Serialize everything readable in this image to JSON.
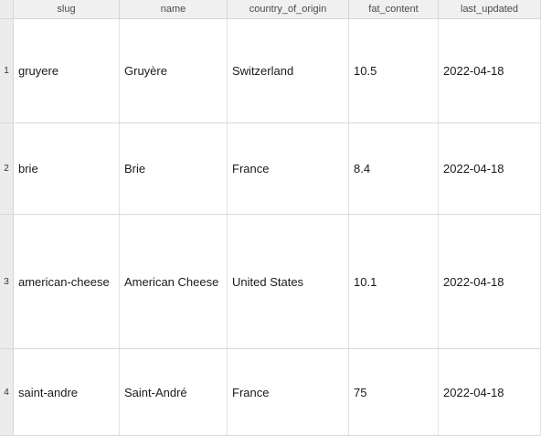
{
  "table": {
    "columns": [
      "slug",
      "name",
      "country_of_origin",
      "fat_content",
      "last_updated"
    ],
    "rows": [
      {
        "num": "1",
        "slug": "gruyere",
        "name": "Gruyère",
        "country_of_origin": "Switzerland",
        "fat_content": "10.5",
        "last_updated": "2022-04-18"
      },
      {
        "num": "2",
        "slug": "brie",
        "name": "Brie",
        "country_of_origin": "France",
        "fat_content": "8.4",
        "last_updated": "2022-04-18"
      },
      {
        "num": "3",
        "slug": "american-cheese",
        "name": "American Cheese",
        "country_of_origin": "United States",
        "fat_content": "10.1",
        "last_updated": "2022-04-18"
      },
      {
        "num": "4",
        "slug": "saint-andre",
        "name": "Saint-André",
        "country_of_origin": "France",
        "fat_content": "75",
        "last_updated": "2022-04-18"
      }
    ]
  }
}
